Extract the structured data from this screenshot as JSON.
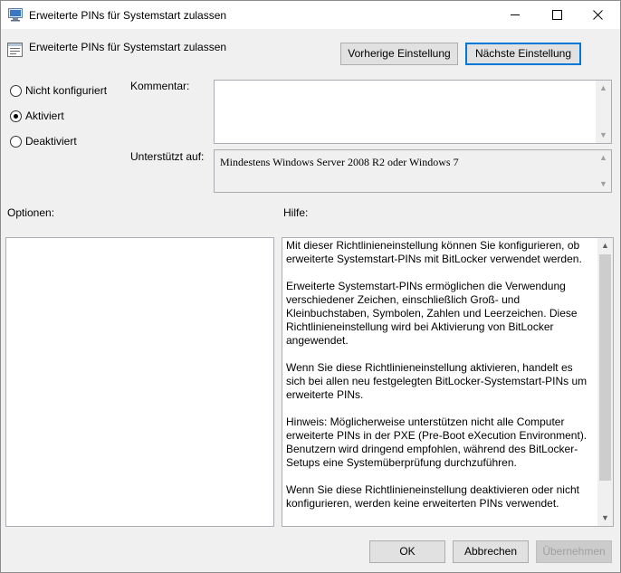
{
  "window": {
    "title": "Erweiterte PINs für Systemstart zulassen",
    "icon": "group-policy-icon"
  },
  "policy": {
    "name": "Erweiterte PINs für Systemstart zulassen",
    "icon": "policy-setting-icon"
  },
  "nav": {
    "prev_label": "Vorherige Einstellung",
    "next_label": "Nächste Einstellung"
  },
  "state": {
    "options": [
      {
        "label": "Nicht konfiguriert",
        "selected": false
      },
      {
        "label": "Aktiviert",
        "selected": true
      },
      {
        "label": "Deaktiviert",
        "selected": false
      }
    ]
  },
  "comment": {
    "label": "Kommentar:",
    "value": ""
  },
  "supported": {
    "label": "Unterstützt auf:",
    "value": "Mindestens Windows Server 2008 R2 oder Windows 7"
  },
  "options_label": "Optionen:",
  "help": {
    "label": "Hilfe:",
    "paragraphs": [
      "Mit dieser Richtlinieneinstellung können Sie konfigurieren, ob erweiterte Systemstart-PINs mit BitLocker verwendet werden.",
      "Erweiterte Systemstart-PINs ermöglichen die Verwendung verschiedener Zeichen, einschließlich Groß- und Kleinbuchstaben, Symbolen, Zahlen und Leerzeichen. Diese Richtlinieneinstellung wird bei Aktivierung von BitLocker angewendet.",
      "Wenn Sie diese Richtlinieneinstellung aktivieren, handelt es sich bei allen neu festgelegten BitLocker-Systemstart-PINs um erweiterte PINs.",
      "Hinweis: Möglicherweise unterstützen nicht alle Computer erweiterte PINs in der PXE (Pre-Boot eXecution Environment). Benutzern wird dringend empfohlen, während des BitLocker-Setups eine Systemüberprüfung durchzuführen.",
      "Wenn Sie diese Richtlinieneinstellung deaktivieren oder nicht konfigurieren, werden keine erweiterten PINs verwendet."
    ]
  },
  "footer": {
    "ok_label": "OK",
    "cancel_label": "Abbrechen",
    "apply_label": "Übernehmen"
  }
}
